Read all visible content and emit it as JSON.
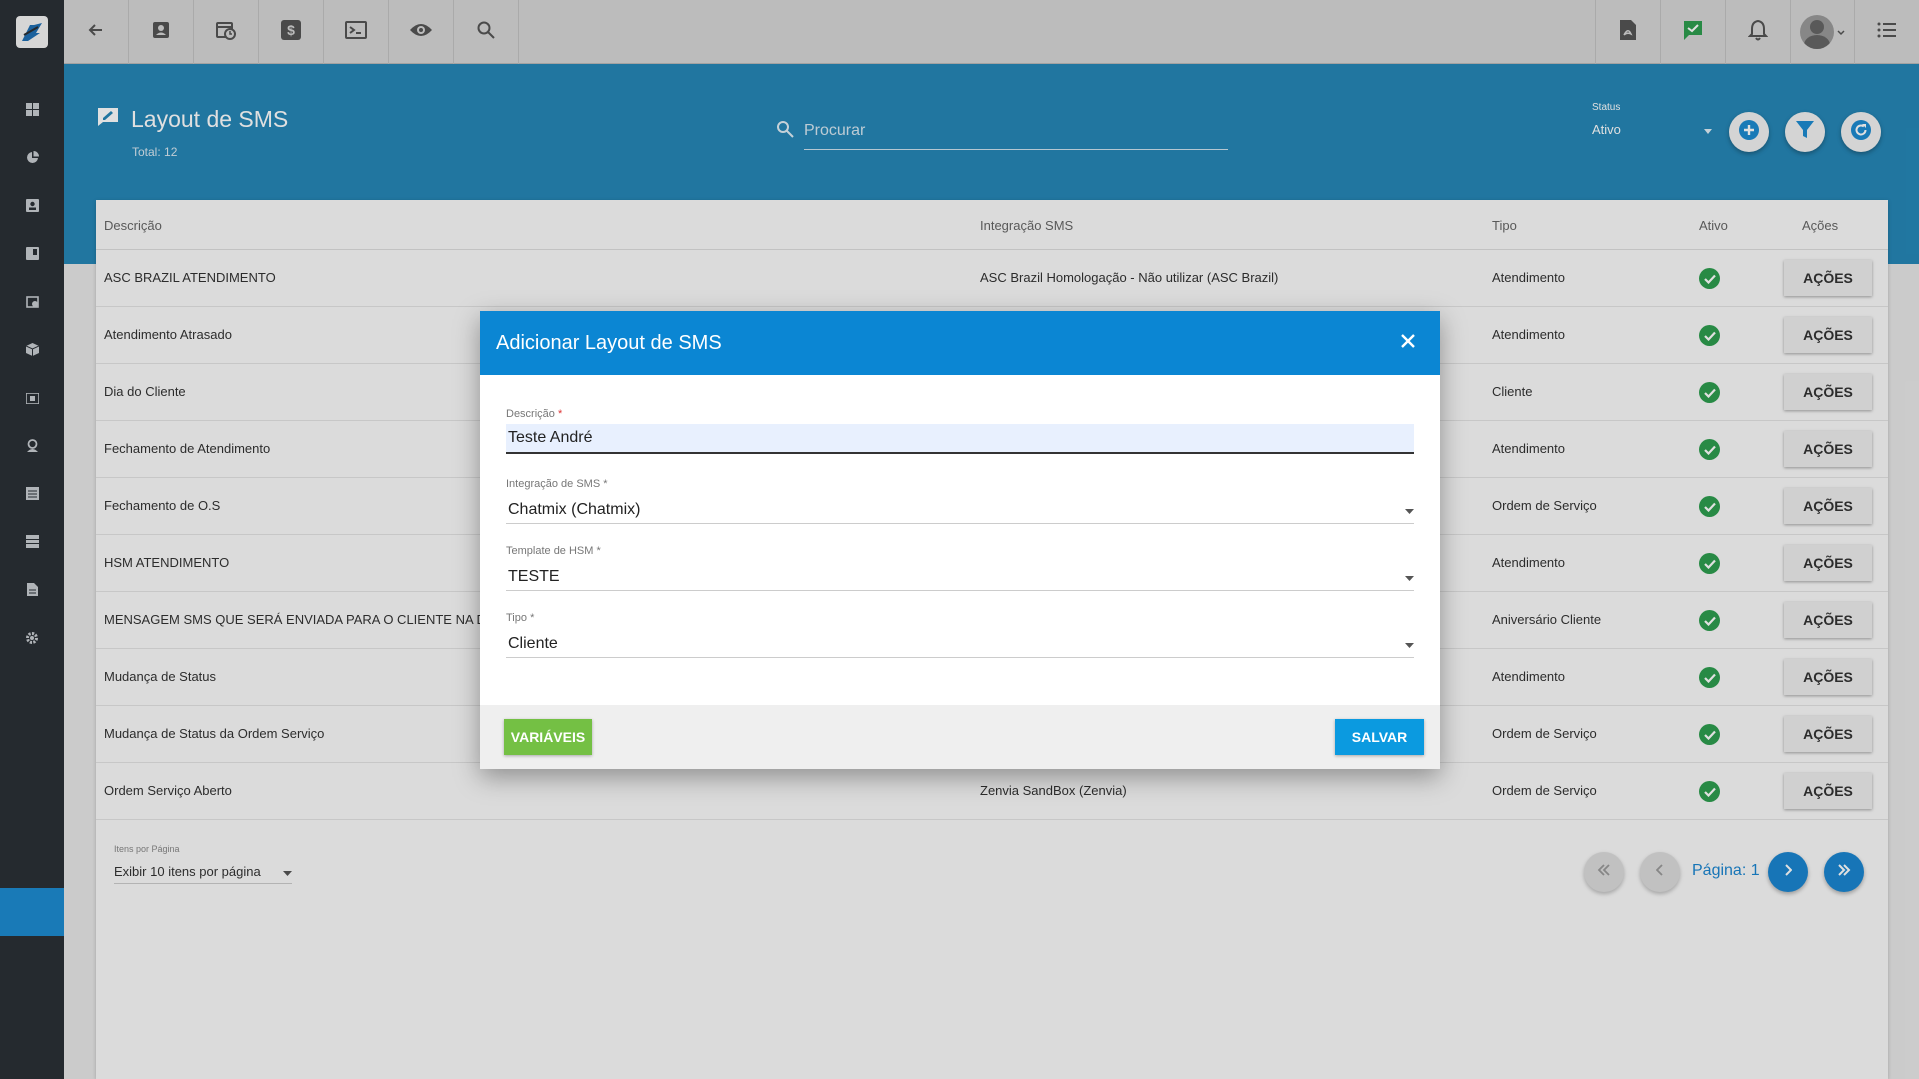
{
  "topbar": {
    "left_icons": [
      "back-icon",
      "contact-card-icon",
      "calendar-clock-icon",
      "dollar-icon",
      "terminal-icon",
      "eye-icon",
      "search-icon"
    ],
    "right_icons": [
      "pdf-icon",
      "chat-check-icon",
      "bell-icon",
      "user-avatar",
      "menu-icon"
    ],
    "chat_icon_color": "#2e9e4f"
  },
  "sidebar": {
    "icons": [
      "dashboard-icon",
      "pie-chart-icon",
      "contacts-icon",
      "book-icon",
      "calendar-icon",
      "package-icon",
      "money-icon",
      "location-icon",
      "list-icon",
      "server-icon",
      "document-icon",
      "settings-icon"
    ],
    "active_color": "#1d8bd1"
  },
  "header": {
    "title": "Layout de SMS",
    "total": "Total: 12",
    "search_placeholder": "Procurar",
    "status_label": "Status",
    "status_value": "Ativo"
  },
  "table": {
    "columns": [
      "Descrição",
      "Integração SMS",
      "Tipo",
      "Ativo",
      "Ações"
    ],
    "action_label": "AÇÕES",
    "rows": [
      {
        "descricao": "ASC BRAZIL ATENDIMENTO",
        "integracao": "ASC Brazil Homologação - Não utilizar (ASC Brazil)",
        "tipo": "Atendimento",
        "ativo": true
      },
      {
        "descricao": "Atendimento Atrasado",
        "integracao": "",
        "tipo": "Atendimento",
        "ativo": true
      },
      {
        "descricao": "Dia do Cliente",
        "integracao": "",
        "tipo": "Cliente",
        "ativo": true
      },
      {
        "descricao": "Fechamento de Atendimento",
        "integracao": "",
        "tipo": "Atendimento",
        "ativo": true
      },
      {
        "descricao": "Fechamento de O.S",
        "integracao": "",
        "tipo": "Ordem de Serviço",
        "ativo": true
      },
      {
        "descricao": "HSM ATENDIMENTO",
        "integracao": "",
        "tipo": "Atendimento",
        "ativo": true
      },
      {
        "descricao": "MENSAGEM SMS QUE SERÁ ENVIADA PARA O CLIENTE NA DATA",
        "integracao": "",
        "tipo": "Aniversário Cliente",
        "ativo": true
      },
      {
        "descricao": "Mudança de Status",
        "integracao": "",
        "tipo": "Atendimento",
        "ativo": true
      },
      {
        "descricao": "Mudança de Status da Ordem Serviço",
        "integracao": "",
        "tipo": "Ordem de Serviço",
        "ativo": true
      },
      {
        "descricao": "Ordem Serviço Aberto",
        "integracao": "Zenvia SandBox (Zenvia)",
        "tipo": "Ordem de Serviço",
        "ativo": true
      }
    ]
  },
  "pagination": {
    "per_page_label": "Itens por Página",
    "per_page_value": "Exibir 10 itens por página",
    "page_label": "Página: 1"
  },
  "modal": {
    "title": "Adicionar Layout de SMS",
    "descricao_label": "Descrição",
    "descricao_value": "Teste André",
    "integracao_label": "Integração de SMS",
    "integracao_value": "Chatmix (Chatmix)",
    "template_label": "Template de HSM",
    "template_value": "TESTE",
    "tipo_label": "Tipo",
    "tipo_value": "Cliente",
    "required_mark": "*",
    "variaveis_label": "VARIÁVEIS",
    "salvar_label": "SALVAR"
  },
  "colors": {
    "header_blue": "#2687b7",
    "modal_blue": "#0b86d3",
    "active_green": "#2e9e4f",
    "variaveis_green": "#74c044",
    "salvar_blue": "#0b9ae0"
  }
}
